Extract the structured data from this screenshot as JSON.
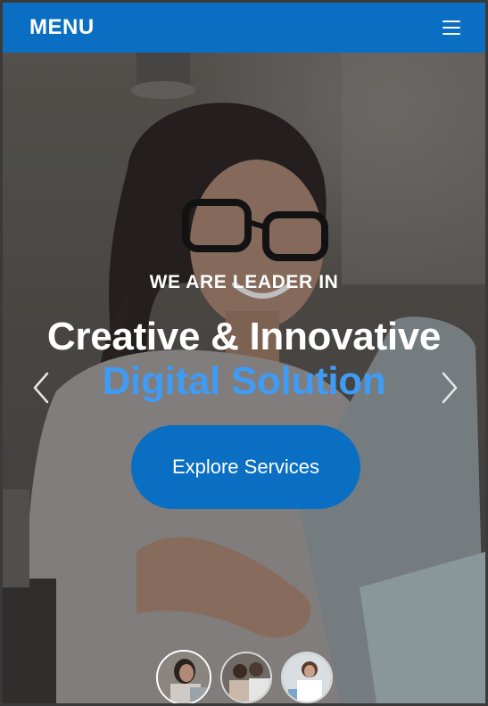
{
  "navbar": {
    "brand": "MENU",
    "menu_icon": "hamburger-menu-icon"
  },
  "hero": {
    "eyebrow": "WE ARE LEADER IN",
    "headline_line1": "Creative & Innovative",
    "headline_line2": "Digital Solution",
    "cta_label": "Explore Services",
    "prev_icon": "chevron-left-icon",
    "next_icon": "chevron-right-icon"
  },
  "colors": {
    "navbar": "#0a6fc2",
    "accent_text": "#3f9bf3",
    "cta": "#0a6fc2"
  },
  "carousel": {
    "thumbnails": [
      "slide-1-thumbnail",
      "slide-2-thumbnail",
      "slide-3-thumbnail"
    ],
    "active_index": 0
  }
}
